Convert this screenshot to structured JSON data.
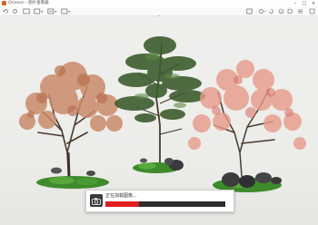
{
  "window": {
    "title": "Oriveon - 图片查看器",
    "app_icon": "app-logo-icon",
    "controls": [
      "minimize-icon",
      "maximize-icon",
      "close-icon"
    ]
  },
  "toolbar": {
    "left_icons": [
      "rotate-left-icon",
      "rotate-right-icon",
      "fullscreen-icon",
      "zoom-dropdown-icon",
      "adjust-dropdown-icon",
      "more-icon"
    ],
    "right_icons": [
      "window-icon",
      "share-icon",
      "rotate-icon",
      "info-icon",
      "tag-icon",
      "settings-icon",
      "pin-icon"
    ]
  },
  "progress_dialog": {
    "message": "正在加载图像...",
    "progress": 0.28,
    "accent": "#e01e1e"
  },
  "colors": {
    "autumn_tree": "#c98b6a",
    "pine_tree": "#3d5c2e",
    "pink_tree": "#e79a8a",
    "moss": "#3f8a2c"
  }
}
